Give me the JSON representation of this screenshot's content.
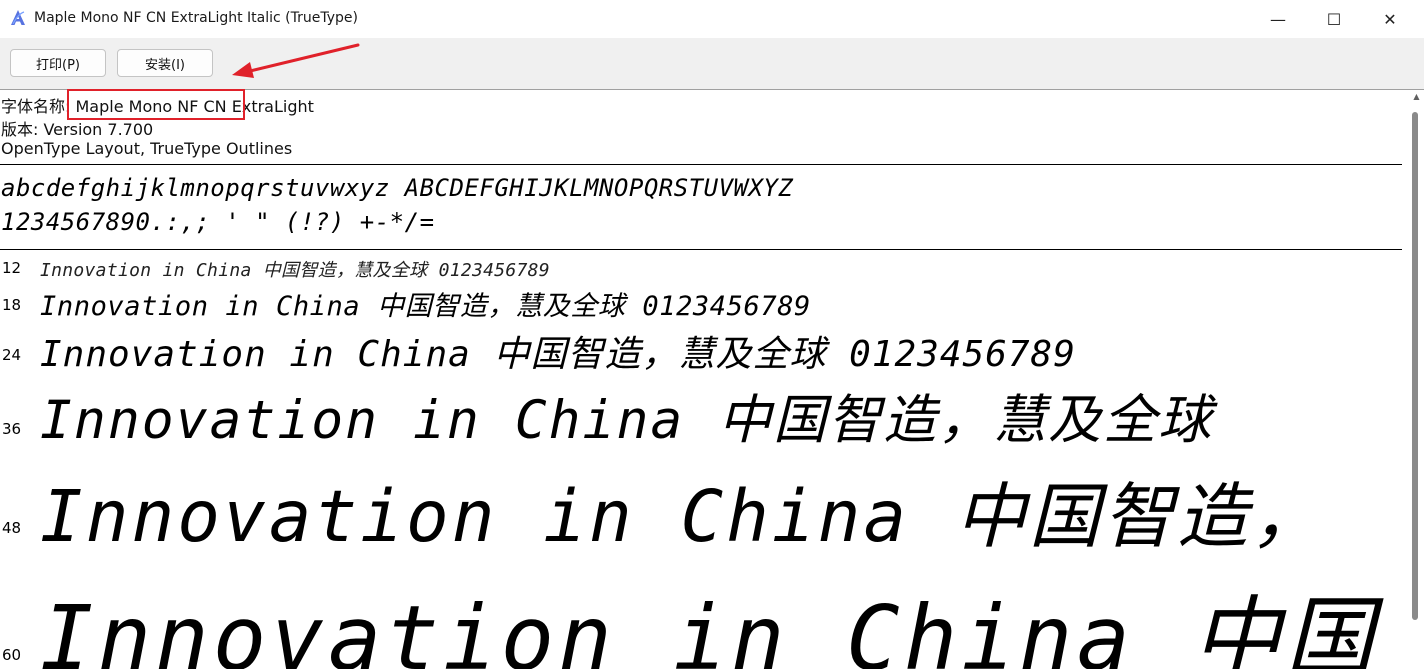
{
  "window": {
    "title": "Maple Mono NF CN ExtraLight Italic (TrueType)",
    "icon": "font-file-icon",
    "controls": {
      "minimize": "—",
      "maximize": "☐",
      "close": "✕"
    }
  },
  "toolbar": {
    "print_label": "打印(P)",
    "install_label": "安装(I)"
  },
  "info": {
    "font_name_label": "字体名称:",
    "font_name_value": "Maple Mono NF CN",
    "font_name_style": "ExtraLight",
    "version": "版本: Version 7.700",
    "outline": "OpenType Layout, TrueType Outlines"
  },
  "charset": {
    "line1": "abcdefghijklmnopqrstuvwxyz ABCDEFGHIJKLMNOPQRSTUVWXYZ",
    "line2": "1234567890.:,; ' \" (!?) +-*/="
  },
  "samples": [
    {
      "size": "12",
      "text": "Innovation in China 中国智造，慧及全球 0123456789"
    },
    {
      "size": "18",
      "text": "Innovation in China 中国智造，慧及全球 0123456789"
    },
    {
      "size": "24",
      "text": "Innovation in China 中国智造，慧及全球 0123456789"
    },
    {
      "size": "36",
      "text": "Innovation in China 中国智造，慧及全球"
    },
    {
      "size": "48",
      "text": "Innovation in China 中国智造，"
    },
    {
      "size": "60",
      "text": "Innovation in China 中国"
    }
  ],
  "colors": {
    "annotation_red": "#e0212a",
    "toolbar_bg": "#f0f0f0"
  }
}
